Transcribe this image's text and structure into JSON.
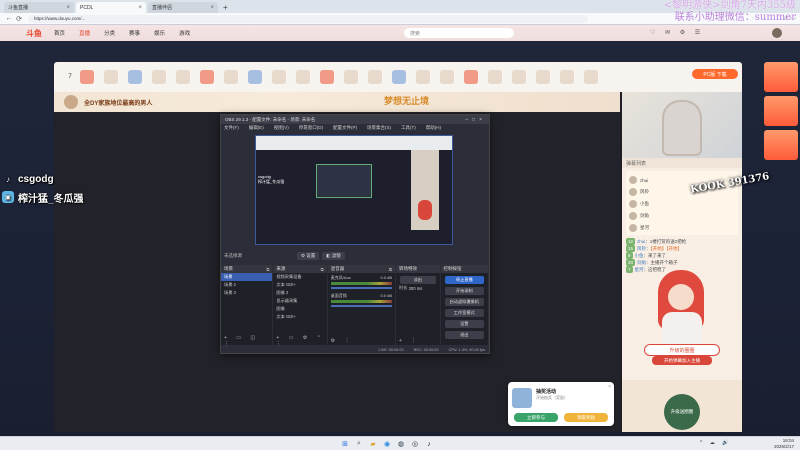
{
  "browser": {
    "tabs": [
      {
        "label": "斗鱼直播",
        "active": false
      },
      {
        "label": "PCDL",
        "active": true
      },
      {
        "label": "直播伴侣",
        "active": false
      }
    ],
    "url": "https://www.douyu.com/..."
  },
  "site": {
    "logo": "斗鱼",
    "nav": [
      "首页",
      "直播",
      "分类",
      "赛事",
      "娱乐",
      "游戏"
    ],
    "search_placeholder": "搜索",
    "pc_button": "PC版 下载"
  },
  "overlay_top_right": {
    "line1": "<黎明游侠>剑角7天内355级",
    "line2": "联系小助理微信：summer"
  },
  "room": {
    "rank_number": "7",
    "banner_text": "全DY家族地位最高的男人",
    "banner_deco": "梦想无止境"
  },
  "streamer_overlay": {
    "tiktok_icon": "tiktok-icon",
    "tiktok_name": "csgodg",
    "bili_icon": "bilibili-icon",
    "bili_name": "榨汁猛_冬瓜强"
  },
  "watermark": "KOOK 391376",
  "obs": {
    "title": "OBS 29.1.3 - 配置文件: 未命名 - 场景: 未命名",
    "menu": [
      "文件(F)",
      "编辑(E)",
      "视图(V)",
      "停靠窗口(D)",
      "配置文件(P)",
      "场景集合(S)",
      "工具(T)",
      "帮助(H)"
    ],
    "scene_label": "未选择源",
    "scene_buttons": [
      "设置",
      "滤镜"
    ],
    "docks": {
      "scenes": {
        "title": "场景",
        "items": [
          "场景",
          "场景 2",
          "场景 3"
        ]
      },
      "sources": {
        "title": "来源",
        "items": [
          "视频采集设备",
          "文本 GDI+",
          "图像 2",
          "显示器采集",
          "图像",
          "文本 GDI+"
        ]
      },
      "mixer": {
        "title": "混音器",
        "rows": [
          {
            "label": "麦克风/Aux",
            "value": "0.0 dB"
          },
          {
            "label": "桌面音频",
            "value": "0.0 dB"
          }
        ]
      },
      "transitions": {
        "title": "转场特效",
        "type": "淡出",
        "duration_label": "时长",
        "duration": "300 ms"
      },
      "controls": {
        "title": "控制按钮",
        "buttons": [
          "停止直播",
          "开始录制",
          "启动虚拟摄像机",
          "工作室模式",
          "设置",
          "退出"
        ]
      }
    },
    "status": {
      "live": "LIVE: 00:00:00",
      "rec": "REC: 00:00:00",
      "cpu": "CPU: 1.3%, 60.00 fps"
    }
  },
  "chat": {
    "header": "弹幕列表",
    "messages": [
      {
        "level": "12",
        "name": "zhui",
        "text": "1楼打赏的送2把枪"
      },
      {
        "level": "15",
        "name": "风铃",
        "text": "【开始】【开始】"
      },
      {
        "level": "9",
        "name": "小鱼",
        "text": "来了来了"
      },
      {
        "level": "20",
        "name": "剑角",
        "text": "主播开个箱子"
      },
      {
        "level": "7",
        "name": "星河",
        "text": "这把稳了"
      }
    ],
    "badge": "升级的圈圈",
    "badge_sub": "开始弹幕加入主播",
    "bottom_circle": "升级送圈圈"
  },
  "popup": {
    "title": "抽奖活动",
    "subtitle": "开始抽奖（奖励）",
    "button_left": "立即参与",
    "button_right": "领取奖励",
    "close": "×"
  },
  "taskbar": {
    "time": "18:04",
    "date": "2026/2/17"
  },
  "colors": {
    "accent": "#e8442e",
    "obs_primary": "#2f66c9",
    "overlay_purple": "#c9a0dc"
  }
}
